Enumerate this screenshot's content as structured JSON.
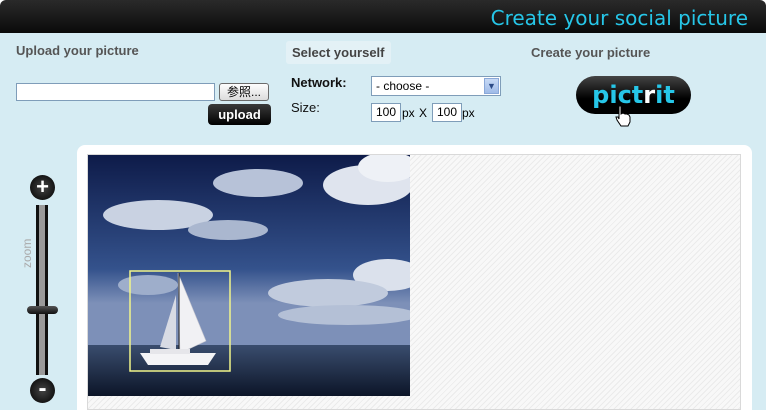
{
  "header": {
    "title": "Create your social picture"
  },
  "upload": {
    "heading": "Upload your picture",
    "file_value": "",
    "browse_label": "参照...",
    "upload_label": "upload"
  },
  "select": {
    "heading": "Select yourself",
    "network_label": "Network:",
    "network_value": "- choose -",
    "size_label": "Size:",
    "width": "100",
    "height": "100",
    "unit_px": "px",
    "times": "X"
  },
  "create": {
    "heading": "Create your picture",
    "button_part1": "pict",
    "button_part2": "r",
    "button_part3": "it"
  },
  "zoom": {
    "label": "zoom",
    "plus": "+",
    "minus": "-"
  },
  "colors": {
    "accent": "#26c6e8",
    "panel_bg": "#d6ecf3",
    "bar_bg": "#0a0a0a"
  }
}
